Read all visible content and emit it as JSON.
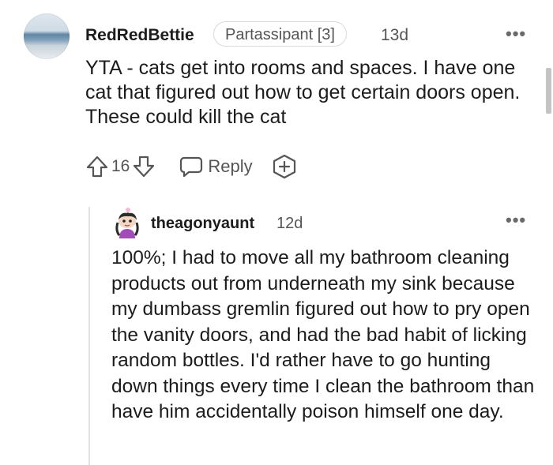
{
  "comment": {
    "username": "RedRedBettie",
    "flair": "Partassipant [3]",
    "time": "13d",
    "more": "•••",
    "body": "YTA - cats get into rooms and spaces. I have one cat that figured out how to get certain doors open. These could kill the cat",
    "score": "16",
    "reply_label": "Reply"
  },
  "reply": {
    "username": "theagonyaunt",
    "time": "12d",
    "more": "•••",
    "body": "100%; I had to move all my bathroom cleaning products out from underneath my sink because my dumbass gremlin figured out how to pry open the vanity doors, and had the bad habit of licking random bottles. I'd rather have to go hunting down things every time I clean the bathroom than have him accidentally poison himself one day."
  },
  "icons": {
    "upvote": "upvote-arrow-icon",
    "downvote": "downvote-arrow-icon",
    "reply": "speech-bubble-icon",
    "award": "award-plus-icon",
    "more": "more-options-icon"
  },
  "colors": {
    "text": "#1c1c1c",
    "muted": "#555555",
    "border": "#d7dadc",
    "thread_line": "#e2e2e2"
  }
}
